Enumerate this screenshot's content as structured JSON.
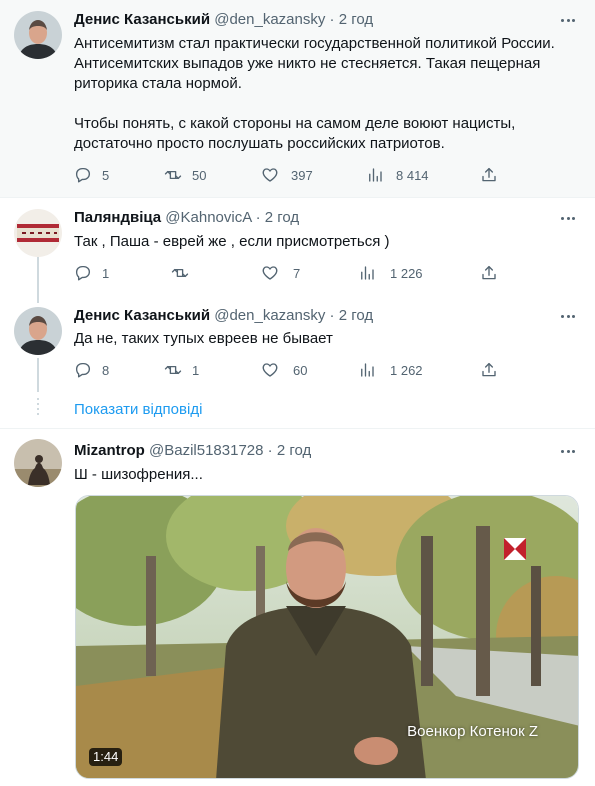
{
  "tweets": [
    {
      "name": "Денис Казанський",
      "handle": "@den_kazansky",
      "dot": "·",
      "time": "2 год",
      "text": "Антисемитизм стал практически государственной политикой России. Антисемитских выпадов уже никто не стесняется. Такая пещерная риторика стала нормой.\n\nЧтобы понять, с какой стороны на самом деле воюют нацисты, достаточно просто послушать российских патриотов.",
      "replies": "5",
      "retweets": "50",
      "likes": "397",
      "views": "8 414"
    },
    {
      "name": "Паляндвіца",
      "handle": "@KahnovicA",
      "dot": "·",
      "time": "2 год",
      "text": "Так , Паша - еврей же , если присмотреться )",
      "replies": "1",
      "retweets": "",
      "likes": "7",
      "views": "1 226"
    },
    {
      "name": "Денис Казанський",
      "handle": "@den_kazansky",
      "dot": "·",
      "time": "2 год",
      "text": "Да не, таких тупых евреев не бывает",
      "replies": "8",
      "retweets": "1",
      "likes": "60",
      "views": "1 262"
    },
    {
      "name": "Mizantrop",
      "handle": "@Bazil51831728",
      "dot": "·",
      "time": "2 год",
      "text": "Ш - шизофрения..."
    }
  ],
  "show_replies": "Показати відповіді",
  "media": {
    "duration": "1:44",
    "watermark": "Военкор Котенок Z"
  },
  "icons": {
    "reply": "reply-icon",
    "retweet": "retweet-icon",
    "like": "heart-icon",
    "views": "views-icon",
    "share": "share-icon",
    "more": "more-icon"
  },
  "colors": {
    "link": "#1d9bf0",
    "secondary_text": "#536471",
    "highlight_bg": "#f7f9f9"
  }
}
